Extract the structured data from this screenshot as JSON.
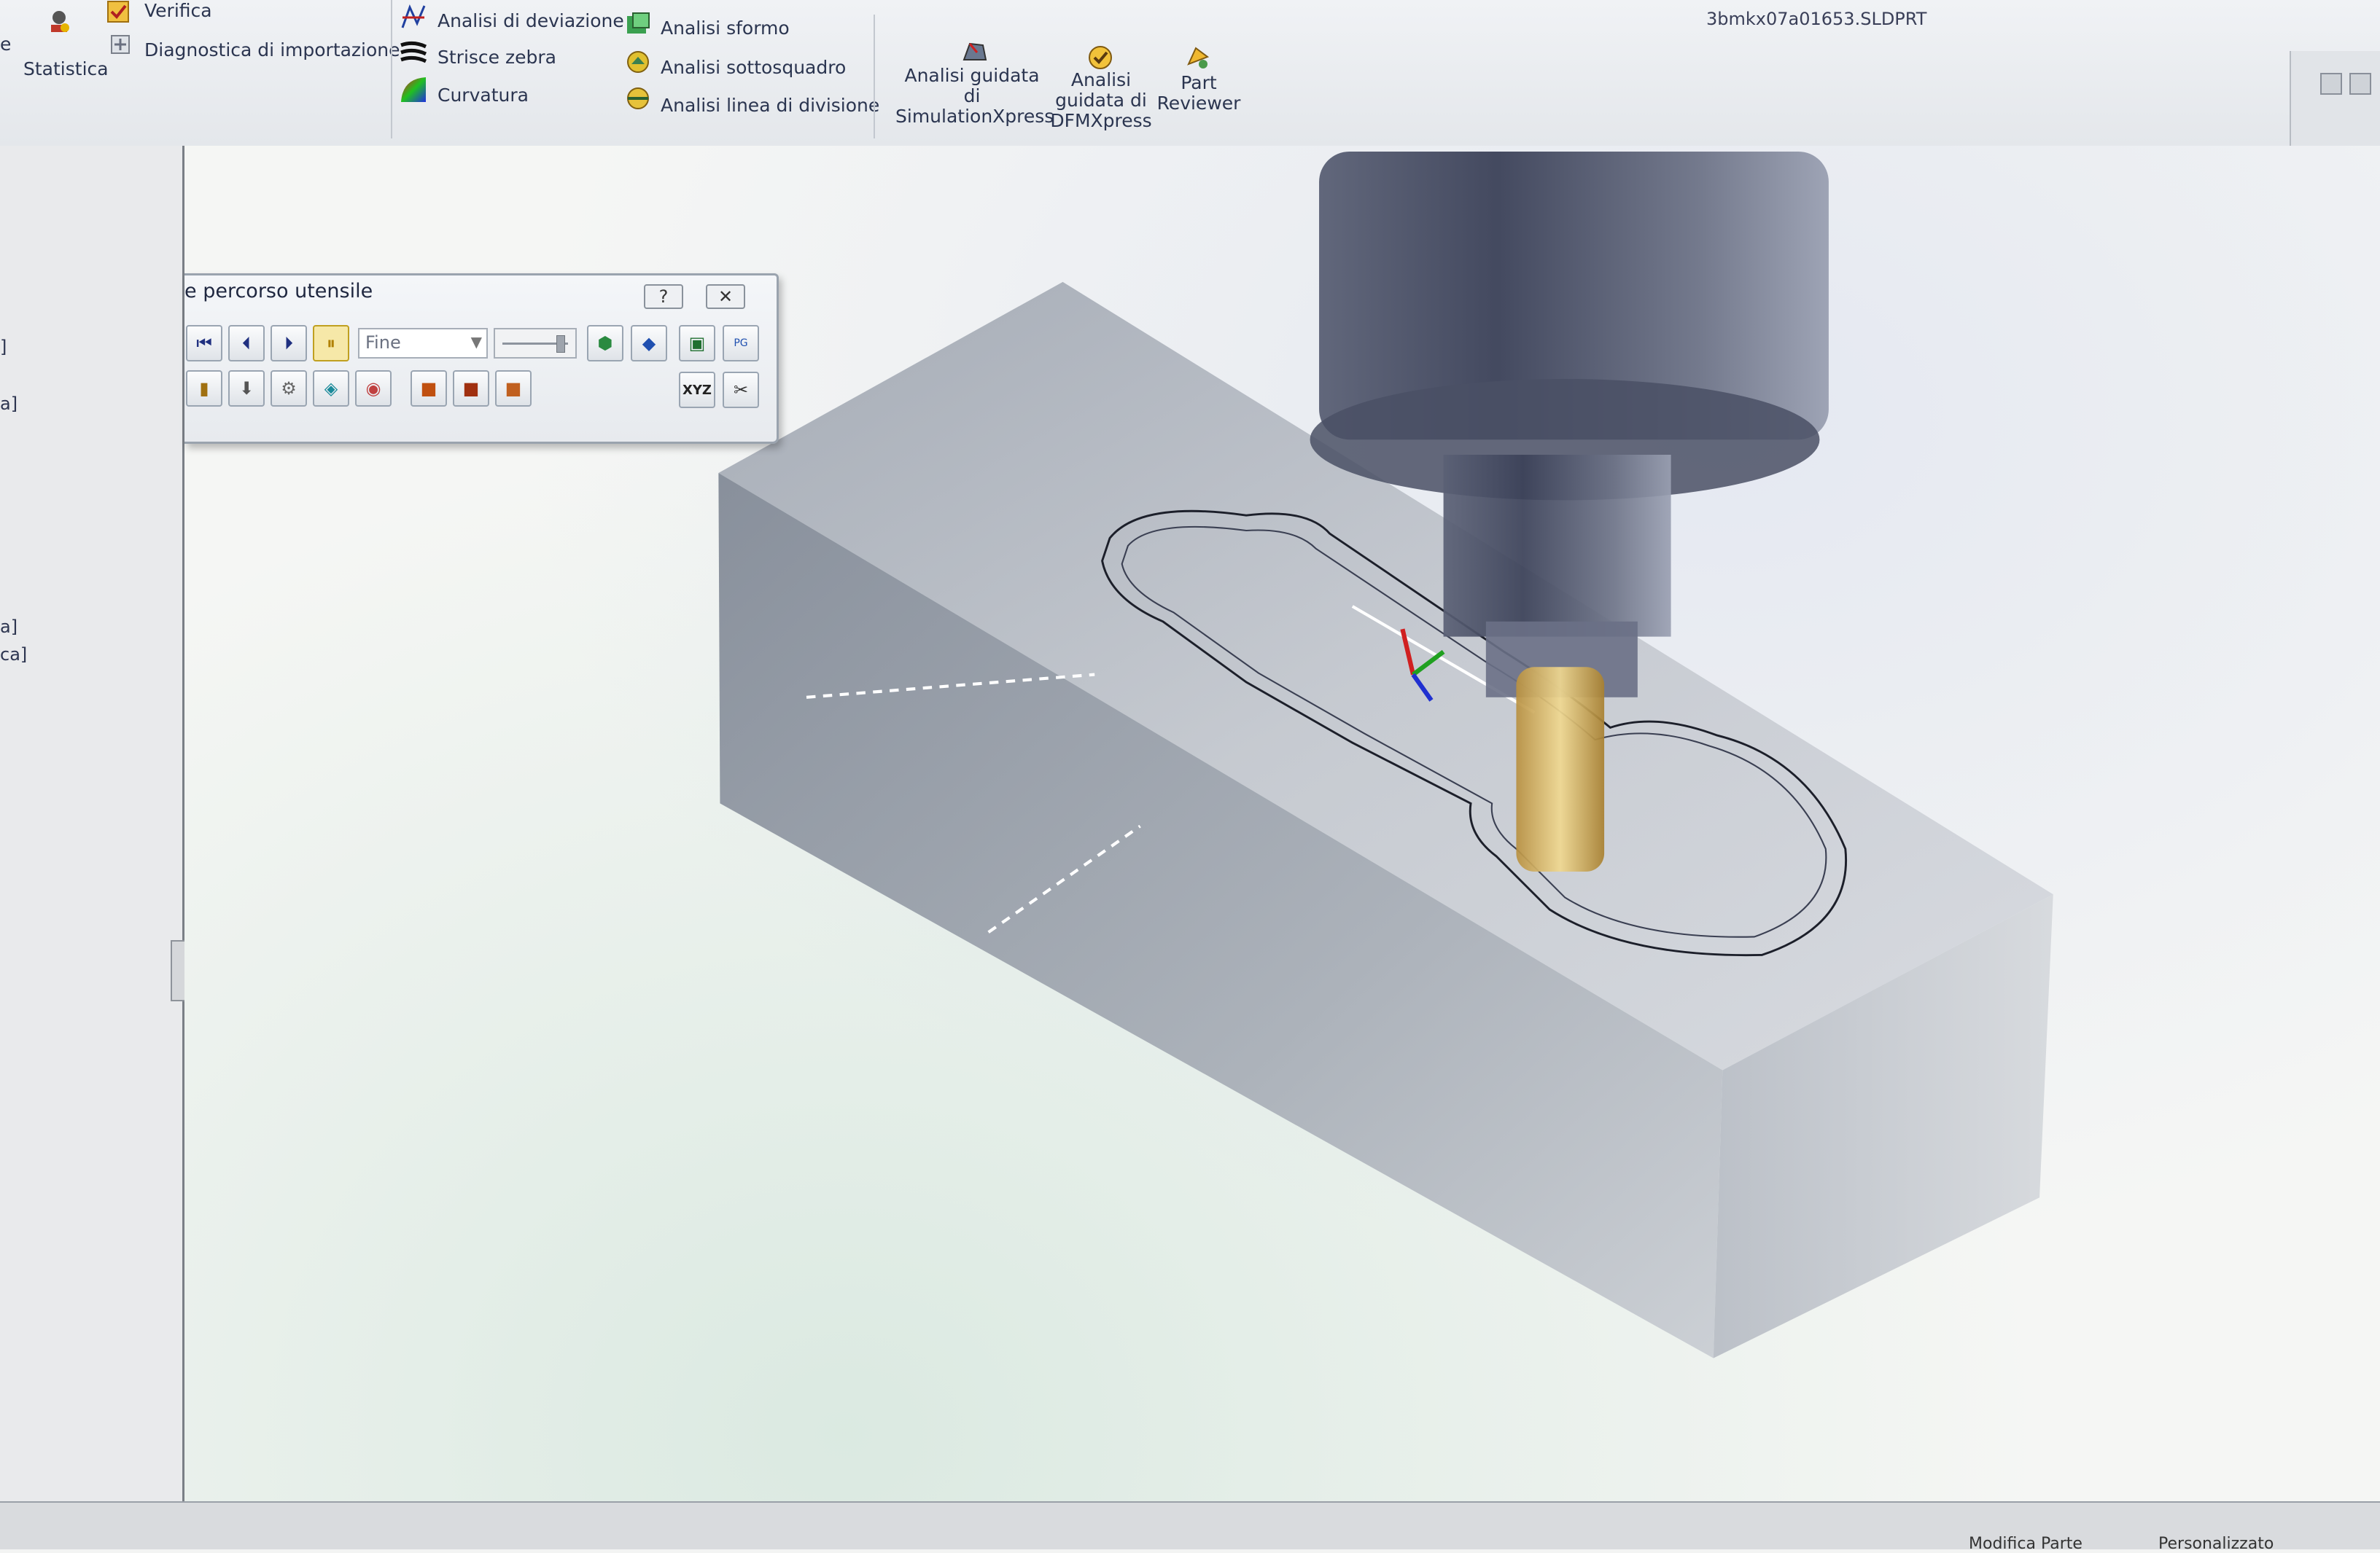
{
  "document": {
    "filename": "3bmkx07a01653.SLDPRT"
  },
  "ribbon": {
    "partial_left_label": "e",
    "statistics": "Statistica",
    "check": "Verifica",
    "import_diagnostics": "Diagnostica di importazione",
    "deviation_analysis": "Analisi di deviazione",
    "zebra_stripes": "Strisce zebra",
    "curvature": "Curvatura",
    "draft_analysis": "Analisi sformo",
    "undercut_analysis": "Analisi sottosquadro",
    "parting_line_analysis": "Analisi linea di divisione",
    "simulationxpress": "Analisi guidata di SimulationXpress",
    "dfmxpress": "Analisi guidata di DFMXpress",
    "part_reviewer": "Part Reviewer"
  },
  "toolpath_panel": {
    "title": "e percorso utensile",
    "help": "?",
    "close": "✕",
    "quality_value": "Fine",
    "xyz_label": "XYZ",
    "save_sub_label": "PG"
  },
  "tree": {
    "items": [
      "]",
      "a]",
      "a]",
      "ca]"
    ]
  },
  "statusbar": {
    "mode": "Modifica Parte",
    "custom": "Personalizzato"
  },
  "colors": {
    "block_top": "#b9bec7",
    "block_front": "#8e959f",
    "block_right": "#c7ccd3",
    "tool_dark": "#4a5065",
    "tool_light": "#c9a85c",
    "ribbon_bg": "#e8ebef"
  },
  "icons": [
    "statistics-icon",
    "check-icon",
    "diagnostics-icon",
    "deviation-icon",
    "zebra-icon",
    "curvature-icon",
    "draft-icon",
    "undercut-icon",
    "parting-line-icon",
    "simulationxpress-icon",
    "dfmxpress-icon",
    "part-reviewer-icon"
  ]
}
